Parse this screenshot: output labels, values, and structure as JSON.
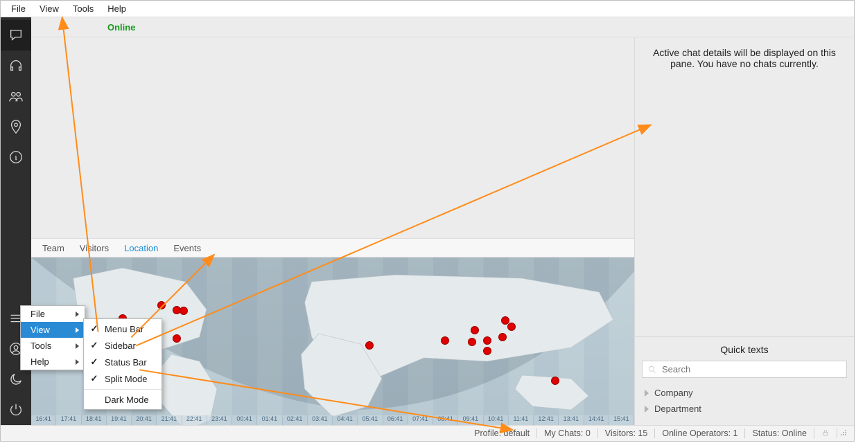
{
  "menubar": {
    "items": [
      "File",
      "View",
      "Tools",
      "Help"
    ]
  },
  "sidebar": {
    "top_icons": [
      "chat-bubble-icon",
      "headset-icon",
      "people-icon",
      "map-pin-icon",
      "info-icon"
    ],
    "bottom_icons": [
      "lines-icon",
      "user-circle-icon",
      "moon-icon",
      "power-icon"
    ]
  },
  "header": {
    "status_label": "Online"
  },
  "tabs": {
    "items": [
      "Team",
      "Visitors",
      "Location",
      "Events"
    ],
    "active_index": 2
  },
  "map": {
    "timezone_hours": [
      "16:41",
      "17:41",
      "18:41",
      "19:41",
      "20:41",
      "21:41",
      "22:41",
      "23:41",
      "00:41",
      "01:41",
      "02:41",
      "03:41",
      "04:41",
      "05:41",
      "06:41",
      "07:41",
      "08:41",
      "09:41",
      "10:41",
      "11:41",
      "12:41",
      "13:41",
      "14:41",
      "15:41"
    ]
  },
  "right_panel": {
    "empty_chat_message": "Active chat details will be displayed on this pane. You have no chats currently.",
    "quick_texts": {
      "title": "Quick texts",
      "search_placeholder": "Search",
      "groups": [
        "Company",
        "Department"
      ]
    }
  },
  "statusbar": {
    "profile": "Profile: default",
    "my_chats": "My Chats: 0",
    "visitors": "Visitors: 15",
    "operators": "Online Operators: 1",
    "status": "Status: Online"
  },
  "context_menu": {
    "root": [
      "File",
      "View",
      "Tools",
      "Help"
    ],
    "highlight_index": 1,
    "submenu": {
      "items": [
        {
          "label": "Menu Bar",
          "checked": true
        },
        {
          "label": "Sidebar",
          "checked": true
        },
        {
          "label": "Status Bar",
          "checked": true
        },
        {
          "label": "Split Mode",
          "checked": true
        },
        {
          "label": "Dark Mode",
          "checked": false
        }
      ]
    }
  }
}
